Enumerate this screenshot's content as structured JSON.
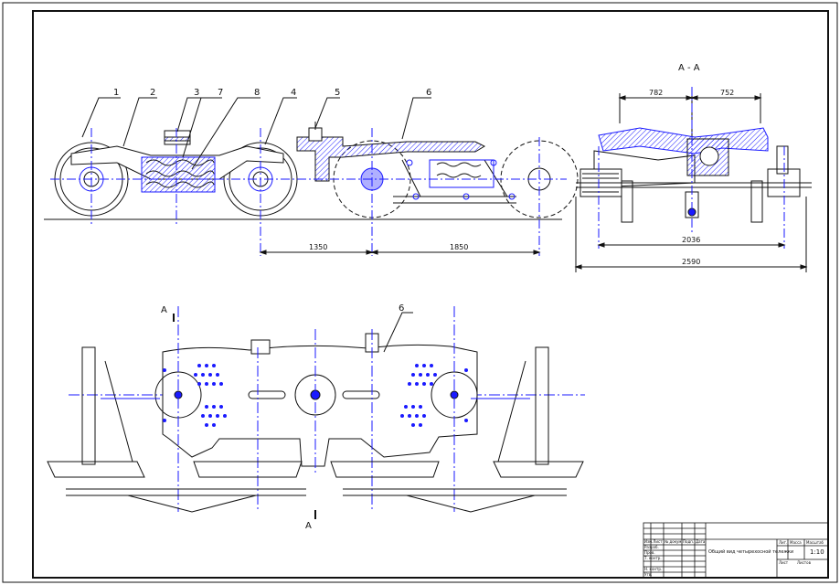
{
  "callouts": [
    "1",
    "2",
    "3",
    "7",
    "8",
    "4",
    "5",
    "6"
  ],
  "plan_callout": "6",
  "section_title": "А - А",
  "section_marks": {
    "top": "А",
    "bottom": "А"
  },
  "dims": {
    "side_left": "1350",
    "side_right": "1850",
    "sec_top_left": "782",
    "sec_top_right": "752",
    "sec_mid": "2036",
    "sec_bottom": "2590"
  },
  "title_block": {
    "drawing_name": "Общий вид четырехосной тележки",
    "scale": "1:10",
    "col_lit": "Лит.",
    "col_mass": "Масса",
    "col_scale": "Масштаб",
    "sheet": "Лист",
    "sheets": "Листов",
    "rows": [
      "Изм.Лист",
      "№ докум.",
      "Подп.",
      "Дата",
      "Разраб.",
      "Пров.",
      "Т. контр.",
      "Н. контр.",
      "Утв."
    ]
  },
  "colors": {
    "line": "#0a0a0a",
    "accent": "#1a1aff",
    "hatch": "#1a1aff"
  }
}
